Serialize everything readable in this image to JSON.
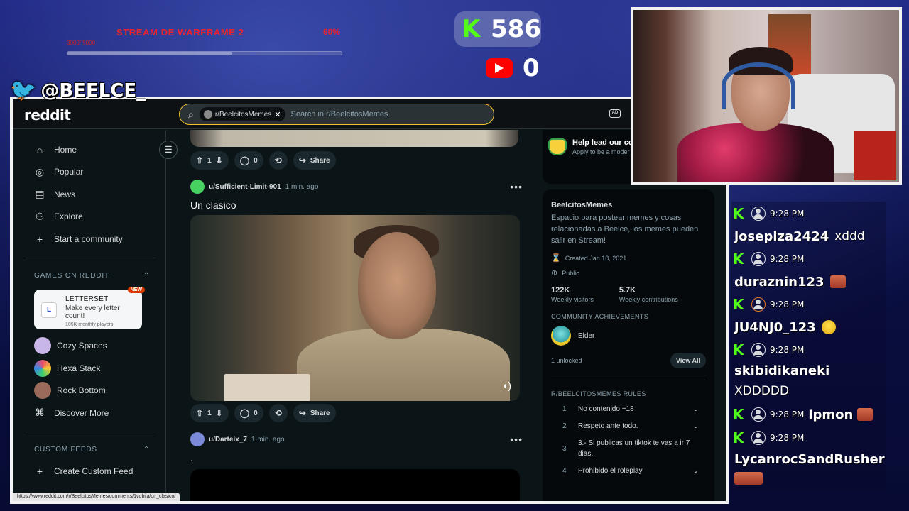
{
  "overlay": {
    "goal_title": "STREAM DE WARFRAME 2",
    "goal_sub": "3000/ 5000",
    "goal_percent_label": "60%",
    "goal_progress": 0.6,
    "kick_count": "586",
    "youtube_count": "0",
    "twitter_handle": "@BEELCE_",
    "kick_glyph": "K",
    "twitter_glyph": "🐦"
  },
  "reddit": {
    "logo": "reddit",
    "search": {
      "chip_label": "r/BeelcitosMemes",
      "placeholder": "Search in r/BeelcitosMemes",
      "search_glyph": "⌕",
      "close_glyph": "✕"
    },
    "header_icon_text": "AD",
    "nav": {
      "items": [
        {
          "label": "Home",
          "icon": "home-icon",
          "glyph": "⌂"
        },
        {
          "label": "Popular",
          "icon": "popular-icon",
          "glyph": "◎"
        },
        {
          "label": "News",
          "icon": "news-icon",
          "glyph": "▤"
        },
        {
          "label": "Explore",
          "icon": "explore-icon",
          "glyph": "⚇"
        },
        {
          "label": "Start a community",
          "icon": "plus-icon",
          "glyph": "+"
        }
      ],
      "games_section": "GAMES ON REDDIT",
      "featured_game": {
        "title": "LETTERSET",
        "desc": "Make every letter count!",
        "players": "105K monthly players",
        "badge": "NEW",
        "icon_letter": "L"
      },
      "games": [
        {
          "label": "Cozy Spaces",
          "color": "#c9b6e8"
        },
        {
          "label": "Hexa Stack",
          "color": "#e84a6a"
        },
        {
          "label": "Rock Bottom",
          "color": "#9a6a5a"
        }
      ],
      "discover": "Discover More",
      "custom_section": "CUSTOM FEEDS",
      "create_feed": "Create Custom Feed",
      "chevron_up_glyph": "⌃",
      "menu_glyph": "☰"
    },
    "status_url": "https://www.reddit.com/r/BeelcitosMemes/comments/1vobila/un_clasico/",
    "feed": {
      "post1_actions": {
        "votes": "1",
        "comments": "0",
        "share": "Share"
      },
      "post2": {
        "user": "u/Sufficient-Limit-901",
        "time": "1 min. ago",
        "title": "Un clasico",
        "votes": "1",
        "comments": "0",
        "share": "Share"
      },
      "post3": {
        "user": "u/Darteix_7",
        "time": "1 min. ago",
        "title": "."
      },
      "glyphs": {
        "upvote": "⇧",
        "downvote": "⇩",
        "comment": "◯",
        "crosspost": "⟲",
        "share": "↪",
        "more": "•••",
        "mute": "◖)"
      }
    },
    "sidebar": {
      "mod_title": "Help lead our cor",
      "mod_sub": "Apply to be a moder",
      "sub_name": "BeelcitosMemes",
      "sub_desc": "Espacio para postear memes y cosas relacionadas a Beelce, los memes pueden salir en Stream!",
      "created": "Created Jan 18, 2021",
      "visibility": "Public",
      "stats": [
        {
          "value": "122K",
          "label": "Weekly visitors"
        },
        {
          "value": "5.7K",
          "label": "Weekly contributions"
        }
      ],
      "achievements_title": "COMMUNITY ACHIEVEMENTS",
      "achievement": "Elder",
      "unlocked": "1 unlocked",
      "view_all": "View All",
      "rules_title": "R/BEELCITOSMEMES RULES",
      "rules": [
        {
          "n": "1",
          "text": "No contenido +18"
        },
        {
          "n": "2",
          "text": "Respeto ante todo."
        },
        {
          "n": "3",
          "text": "3.- Si publicas un tiktok te vas a ir 7 dias."
        },
        {
          "n": "4",
          "text": "Prohibido el roleplay"
        }
      ],
      "cake_glyph": "⌛",
      "globe_glyph": "⊕",
      "chevron_down_glyph": "⌄"
    }
  },
  "chat": [
    {
      "time": "9:28 PM",
      "user": "josepiza2424",
      "msg": "xddd",
      "emote": ""
    },
    {
      "time": "9:28 PM",
      "user": "duraznin123",
      "msg": "",
      "emote": "face"
    },
    {
      "time": "9:28 PM",
      "user": "JU4NJ0_123",
      "msg": "",
      "emote": "smile"
    },
    {
      "time": "9:28 PM",
      "user": "skibidikaneki",
      "msg": "XDDDDD",
      "emote": ""
    },
    {
      "time": "9:28 PM",
      "user": "lpmon",
      "msg": "",
      "emote": "face"
    },
    {
      "time": "9:28 PM",
      "user": "LycanrocSandRusher",
      "msg": "",
      "emote": "face"
    }
  ]
}
